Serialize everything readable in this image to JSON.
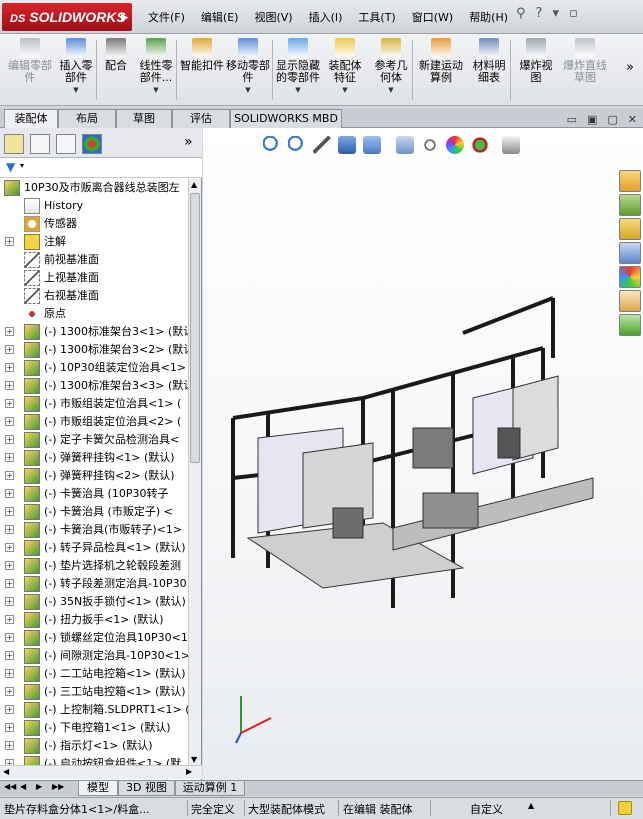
{
  "app": {
    "logo": "SOLIDWORKS",
    "logo_prefix": "DS"
  },
  "menu": [
    "文件(F)",
    "编辑(E)",
    "视图(V)",
    "插入(I)",
    "工具(T)",
    "窗口(W)",
    "帮助(H)"
  ],
  "ribbon": [
    {
      "label": "编辑零部件",
      "disabled": true
    },
    {
      "label": "插入零部件",
      "disabled": false
    },
    {
      "label": "配合",
      "disabled": false
    },
    {
      "label": "线性零部件...",
      "disabled": false
    },
    {
      "label": "智能扣件",
      "disabled": false
    },
    {
      "label": "移动零部件",
      "disabled": false
    },
    {
      "label": "显示隐藏的零部件",
      "disabled": false
    },
    {
      "label": "装配体特征",
      "disabled": false
    },
    {
      "label": "参考几何体",
      "disabled": false
    },
    {
      "label": "新建运动算例",
      "disabled": false
    },
    {
      "label": "材料明细表",
      "disabled": false
    },
    {
      "label": "爆炸视图",
      "disabled": false
    },
    {
      "label": "爆炸直线草图",
      "disabled": true
    }
  ],
  "tabs": [
    "装配体",
    "布局",
    "草图",
    "评估",
    "SOLIDWORKS MBD"
  ],
  "tree": {
    "root": "10P30及市贩离合器线总装图左",
    "fixed": [
      "History",
      "传感器",
      "注解",
      "前视基准面",
      "上视基准面",
      "右视基准面",
      "原点"
    ],
    "components": [
      "(-) 1300标准架台3<1> (默认",
      "(-) 1300标准架台3<2> (默认",
      "(-) 10P30组装定位治具<1>",
      "(-) 1300标准架台3<3> (默认",
      "(-) 市贩组装定位治具<1> (",
      "(-) 市贩组装定位治具<2> (",
      "(-) 定子卡簧欠品检测治具<",
      "(-) 弹簧秤挂钩<1> (默认)",
      "(-) 弹簧秤挂钩<2> (默认)",
      "(-) 卡簧治具 (10P30转子",
      "(-) 卡簧治具 (市贩定子) <",
      "(-) 卡簧治具(市贩转子)<1>",
      "(-) 转子异品检具<1> (默认)",
      "(-) 垫片选择机之轮毂段差测",
      "(-) 转子段差测定治具-10P30",
      "(-) 35N扳手锁付<1> (默认)",
      "(-) 扭力扳手<1> (默认)",
      "(-) 锁螺丝定位治具10P30<1",
      "(-) 间隙测定治具-10P30<1>",
      "(-) 二工站电控箱<1> (默认)",
      "(-) 三工站电控箱<1> (默认)",
      "(-) 上控制箱.SLDPRT1<1> (",
      "(-) 下电控箱1<1> (默认)",
      "(-) 指示灯<1> (默认)",
      "(-) 启动按钮盒组件<1> (默"
    ]
  },
  "bottom_tabs": [
    "模型",
    "3D 视图",
    "运动算例 1"
  ],
  "status": {
    "item": "垫片存料盒分体1<1>/料盒...",
    "definition": "完全定义",
    "mode": "大型装配体模式",
    "editing": "在编辑 装配体",
    "custom": "自定义"
  },
  "colors": {
    "accent": "#cc1f26",
    "frame": "#1a1a1a",
    "panel": "#e9e4f2"
  }
}
